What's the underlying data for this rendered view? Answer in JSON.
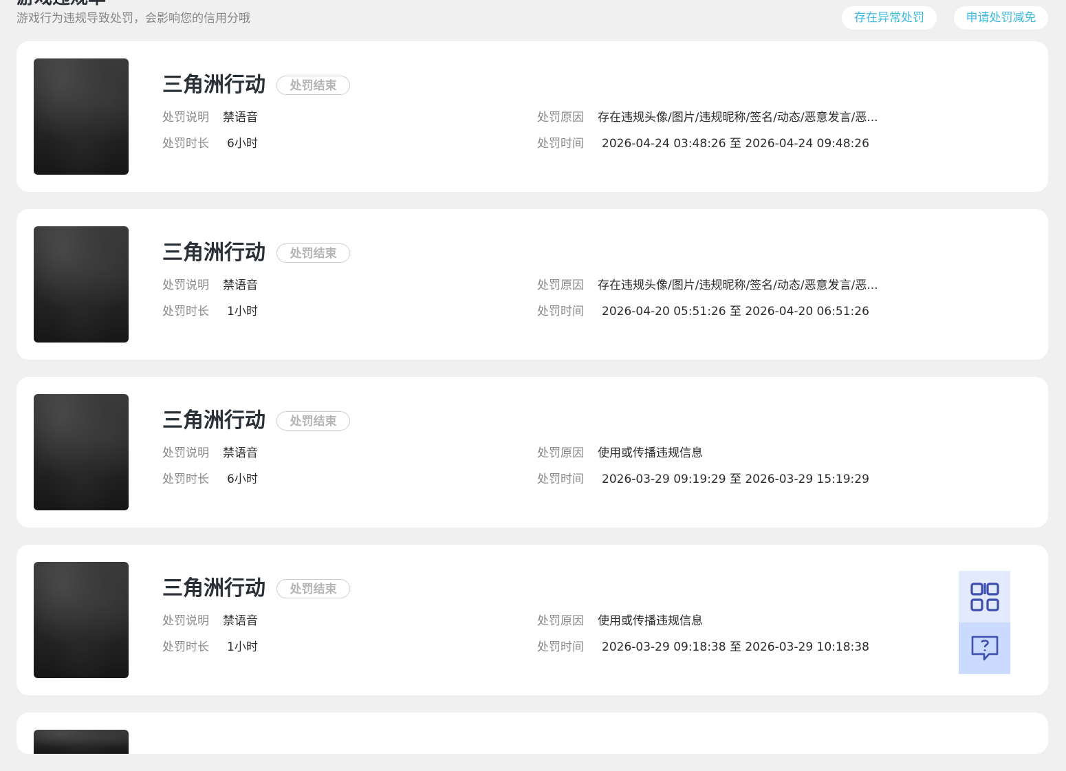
{
  "header": {
    "title": "游戏违规单",
    "subtitle": "游戏行为违规导致处罚，会影响您的信用分哦",
    "abnormal_button": "存在异常处罚",
    "appeal_button": "申请处罚减免"
  },
  "labels": {
    "desc": "处罚说明",
    "duration": "处罚时长",
    "reason": "处罚原因",
    "time": "处罚时间"
  },
  "records": [
    {
      "game": "三角洲行动",
      "status": "处罚结束",
      "desc": "禁语音",
      "duration": "6小时",
      "reason": "存在违规头像/图片/违规昵称/签名/动态/恶意发言/恶...",
      "time": "2026-04-24 03:48:26 至 2026-04-24 09:48:26"
    },
    {
      "game": "三角洲行动",
      "status": "处罚结束",
      "desc": "禁语音",
      "duration": "1小时",
      "reason": "存在违规头像/图片/违规昵称/签名/动态/恶意发言/恶...",
      "time": "2026-04-20 05:51:26 至 2026-04-20 06:51:26"
    },
    {
      "game": "三角洲行动",
      "status": "处罚结束",
      "desc": "禁语音",
      "duration": "6小时",
      "reason": "使用或传播违规信息",
      "time": "2026-03-29 09:19:29 至 2026-03-29 15:19:29"
    },
    {
      "game": "三角洲行动",
      "status": "处罚结束",
      "desc": "禁语音",
      "duration": "1小时",
      "reason": "使用或传播违规信息",
      "time": "2026-03-29 09:18:38 至 2026-03-29 10:18:38"
    }
  ],
  "float_panel": {
    "qr_icon": "qr-code-icon",
    "help_icon": "help-chat-icon"
  },
  "colors": {
    "accent": "#3cb8e0",
    "page_bg": "#f0f0f0",
    "float_qr_bg": "#e2eafc",
    "float_help_bg": "#cadbff",
    "float_icon": "#3d4fae"
  }
}
